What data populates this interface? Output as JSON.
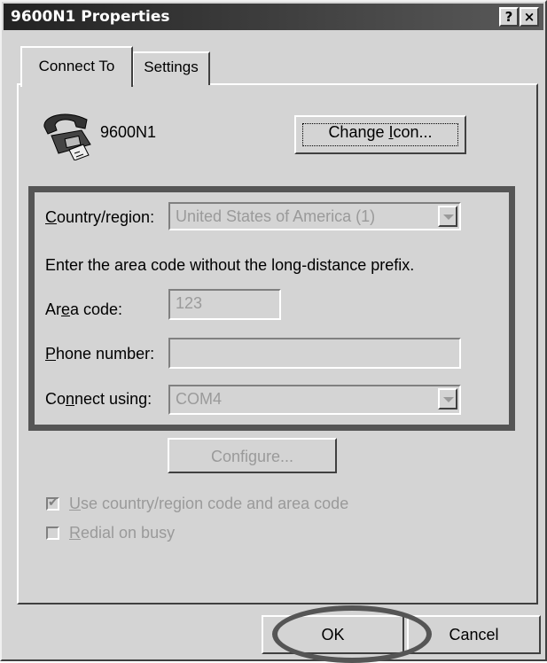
{
  "window": {
    "title": "9600N1 Properties",
    "help_button": "?",
    "close_button": "×"
  },
  "tabs": [
    {
      "label": "Connect To",
      "active": true
    },
    {
      "label": "Settings",
      "active": false
    }
  ],
  "device": {
    "name": "9600N1",
    "icon": "telephone-icon",
    "change_icon_button": {
      "prefix": "Change ",
      "accel": "I",
      "suffix": "con..."
    }
  },
  "form": {
    "country_label": {
      "accel": "C",
      "rest": "ountry/region:"
    },
    "country_value": "United States of America (1)",
    "instruction": "Enter the area code without the long-distance prefix.",
    "area_label": {
      "pre": "Ar",
      "accel": "e",
      "post": "a code:"
    },
    "area_value": "123",
    "phone_label": {
      "accel": "P",
      "rest": "hone number:"
    },
    "phone_value": "",
    "connect_label": {
      "pre": "Co",
      "accel": "n",
      "post": "nect using:"
    },
    "connect_value": "COM4",
    "configure_button": {
      "pre": "Confi",
      "accel": "g",
      "post": "ure..."
    }
  },
  "options": {
    "use_country_code": {
      "accel": "U",
      "rest": "se country/region code and area code",
      "checked": true
    },
    "redial_on_busy": {
      "accel": "R",
      "rest": "edial on busy",
      "checked": false
    }
  },
  "footer": {
    "ok_label": "OK",
    "cancel_label": "Cancel"
  },
  "colors": {
    "annotation": "#555555",
    "disabled_text": "#9a9a9a"
  }
}
